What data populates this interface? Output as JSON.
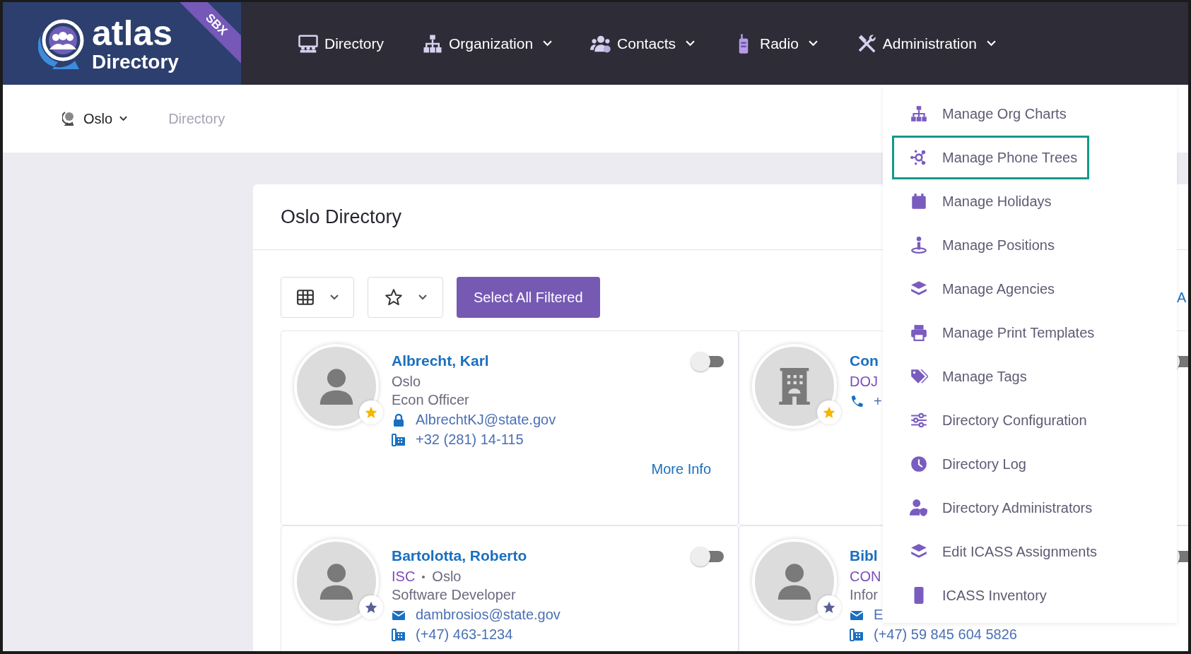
{
  "logo": {
    "word": "atlas",
    "subtitle": "Directory",
    "badge": "SBX"
  },
  "nav": [
    {
      "label": "Directory",
      "has_caret": false
    },
    {
      "label": "Organization",
      "has_caret": true
    },
    {
      "label": "Contacts",
      "has_caret": true
    },
    {
      "label": "Radio",
      "has_caret": true
    },
    {
      "label": "Administration",
      "has_caret": true
    }
  ],
  "breadcrumb": {
    "post": "Oslo",
    "page": "Directory"
  },
  "panel": {
    "title": "Oslo Directory",
    "select_button": "Select All Filtered",
    "cut_link": "A"
  },
  "cards": [
    {
      "kind": "person",
      "name": "Albrecht, Karl",
      "location": "Oslo",
      "title": "Econ Officer",
      "contact_lines": [
        {
          "kind": "lock",
          "text": "AlbrechtKJ@state.gov"
        },
        {
          "kind": "desk_phone",
          "text": "+32 (281) 14-115"
        }
      ],
      "more_info": "More Info",
      "favorite": true,
      "on": false
    },
    {
      "kind": "building",
      "name": "Con",
      "org": "DOJ",
      "contact_lines": [
        {
          "kind": "mobile_phone",
          "text": "+"
        }
      ],
      "favorite": true,
      "on": false
    },
    {
      "kind": "person",
      "name": "Bartolotta, Roberto",
      "org": "ISC",
      "location": "Oslo",
      "title": "Software Developer",
      "contact_lines": [
        {
          "kind": "envelope",
          "text": "dambrosios@state.gov"
        },
        {
          "kind": "desk_phone",
          "text": "(+47) 463-1234"
        }
      ],
      "favorite": false,
      "on": false
    },
    {
      "kind": "person",
      "name": "Bibl",
      "org": "CON",
      "title": "Infor",
      "contact_lines": [
        {
          "kind": "envelope",
          "text": "E"
        },
        {
          "kind": "desk_phone",
          "text": "(+47) 59 845 604 5826"
        }
      ],
      "favorite": false,
      "on": false
    }
  ],
  "admin_menu": [
    {
      "label": "Manage Org Charts",
      "selected": false
    },
    {
      "label": "Manage Phone Trees",
      "selected": true
    },
    {
      "label": "Manage Holidays",
      "selected": false
    },
    {
      "label": "Manage Positions",
      "selected": false
    },
    {
      "label": "Manage Agencies",
      "selected": false
    },
    {
      "label": "Manage Print Templates",
      "selected": false
    },
    {
      "label": "Manage Tags",
      "selected": false
    },
    {
      "label": "Directory Configuration",
      "selected": false
    },
    {
      "label": "Directory Log",
      "selected": false
    },
    {
      "label": "Directory Administrators",
      "selected": false
    },
    {
      "label": "Edit ICASS Assignments",
      "selected": false
    },
    {
      "label": "ICASS Inventory",
      "selected": false
    }
  ]
}
